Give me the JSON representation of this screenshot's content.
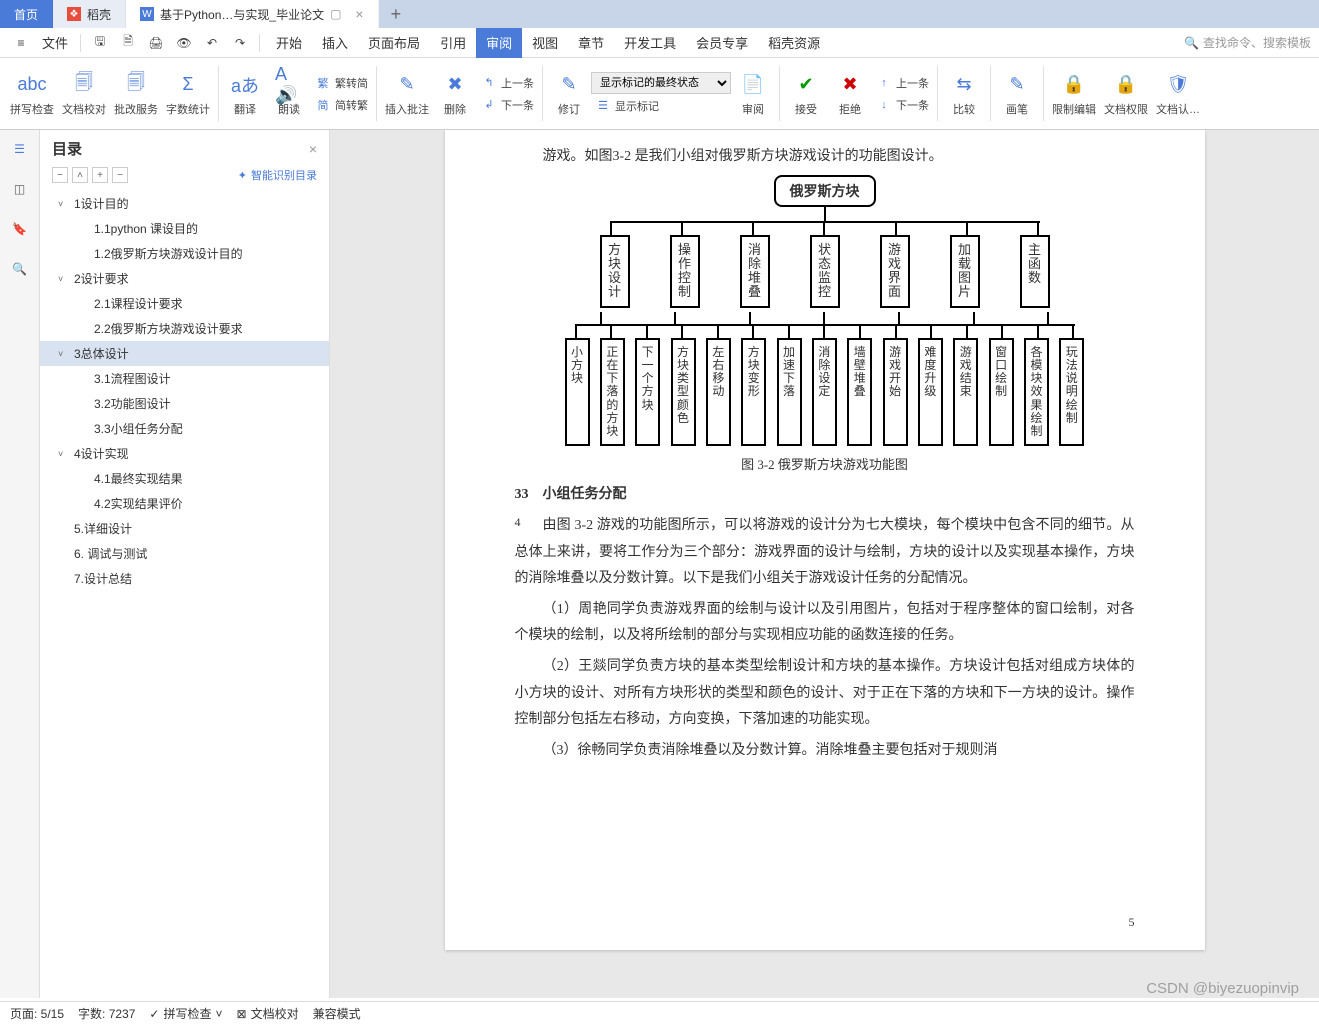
{
  "tabs": {
    "home": "首页",
    "doc1": "稻壳",
    "doc2": "基于Python…与实现_毕业论文",
    "add": "+"
  },
  "file_menu": "文件",
  "menu_tabs": [
    "开始",
    "插入",
    "页面布局",
    "引用",
    "审阅",
    "视图",
    "章节",
    "开发工具",
    "会员专享",
    "稻壳资源"
  ],
  "active_menu_index": 4,
  "search_placeholder": "查找命令、搜索模板",
  "ribbon": {
    "spell": "拼写检查",
    "proof": "文档校对",
    "bulk": "批改服务",
    "wordcount": "字数统计",
    "translate": "翻译",
    "read": "朗读",
    "fanjian": "繁转简",
    "jianfan": "简转繁",
    "insert_comment": "插入批注",
    "delete": "删除",
    "prev_comment": "上一条",
    "next_comment": "下一条",
    "revise": "修订",
    "show_markup_state": "显示标记的最终状态",
    "show_markup": "显示标记",
    "review": "审阅",
    "accept": "接受",
    "reject": "拒绝",
    "prev_change": "上一条",
    "next_change": "下一条",
    "compare": "比较",
    "brush": "画笔",
    "restrict_edit": "限制编辑",
    "doc_perm": "文档权限",
    "doc_auth": "文档认…"
  },
  "outline": {
    "title": "目录",
    "smart_detect": "智能识别目录",
    "items": [
      {
        "lvl": 1,
        "exp": true,
        "text": "1设计目的"
      },
      {
        "lvl": 2,
        "text": "1.1python 课设目的"
      },
      {
        "lvl": 2,
        "text": "1.2俄罗斯方块游戏设计目的"
      },
      {
        "lvl": 1,
        "exp": true,
        "text": "2设计要求"
      },
      {
        "lvl": 2,
        "text": "2.1课程设计要求"
      },
      {
        "lvl": 2,
        "text": "2.2俄罗斯方块游戏设计要求"
      },
      {
        "lvl": 1,
        "exp": true,
        "sel": true,
        "text": "3总体设计"
      },
      {
        "lvl": 2,
        "text": "3.1流程图设计"
      },
      {
        "lvl": 2,
        "text": "3.2功能图设计"
      },
      {
        "lvl": 2,
        "text": "3.3小组任务分配"
      },
      {
        "lvl": 1,
        "exp": true,
        "text": "4设计实现"
      },
      {
        "lvl": 2,
        "text": "4.1最终实现结果"
      },
      {
        "lvl": 2,
        "text": "4.2实现结果评价"
      },
      {
        "lvl": 1,
        "text": "5.详细设计"
      },
      {
        "lvl": 1,
        "text": "6. 调试与测试"
      },
      {
        "lvl": 1,
        "text": "7.设计总结"
      }
    ]
  },
  "doc": {
    "top_line": "游戏。如图3-2 是我们小组对俄罗斯方块游戏设计的功能图设计。",
    "diagram": {
      "root": "俄罗斯方块",
      "level2": [
        "方块设计",
        "操作控制",
        "消除堆叠",
        "状态监控",
        "游戏界面",
        "加载图片",
        "主函数"
      ],
      "level3": [
        "小方块",
        "正在下落的方块",
        "下一个方块",
        "方块类型颜色",
        "左右移动",
        "方块变形",
        "加速下落",
        "消除设定",
        "墙壁堆叠",
        "游戏开始",
        "难度升级",
        "游戏结束",
        "窗口绘制",
        "各模块效果绘制",
        "玩法说明绘制"
      ]
    },
    "caption": "图 3-2 俄罗斯方块游戏功能图",
    "heading": "33　小组任务分配",
    "p1": "由图 3-2 游戏的功能图所示，可以将游戏的设计分为七大模块，每个模块中包含不同的细节。从总体上来讲，要将工作分为三个部分：游戏界面的设计与绘制，方块的设计以及实现基本操作，方块的消除堆叠以及分数计算。以下是我们小组关于游戏设计任务的分配情况。",
    "p2": "（1）周艳同学负责游戏界面的绘制与设计以及引用图片，包括对于程序整体的窗口绘制，对各个模块的绘制，以及将所绘制的部分与实现相应功能的函数连接的任务。",
    "p3": "（2）王燚同学负责方块的基本类型绘制设计和方块的基本操作。方块设计包括对组成方块体的小方块的设计、对所有方块形状的类型和颜色的设计、对于正在下落的方块和下一方块的设计。操作控制部分包括左右移动，方向变换，下落加速的功能实现。",
    "p4": "（3）徐畅同学负责消除堆叠以及分数计算。消除堆叠主要包括对于规则消",
    "page_left": "4",
    "page_right": "5"
  },
  "status": {
    "page": "页面: 5/15",
    "words": "字数: 7237",
    "spell": "拼写检查",
    "proof": "文档校对",
    "compat": "兼容模式"
  },
  "watermark": "CSDN @biyezuopinvip"
}
